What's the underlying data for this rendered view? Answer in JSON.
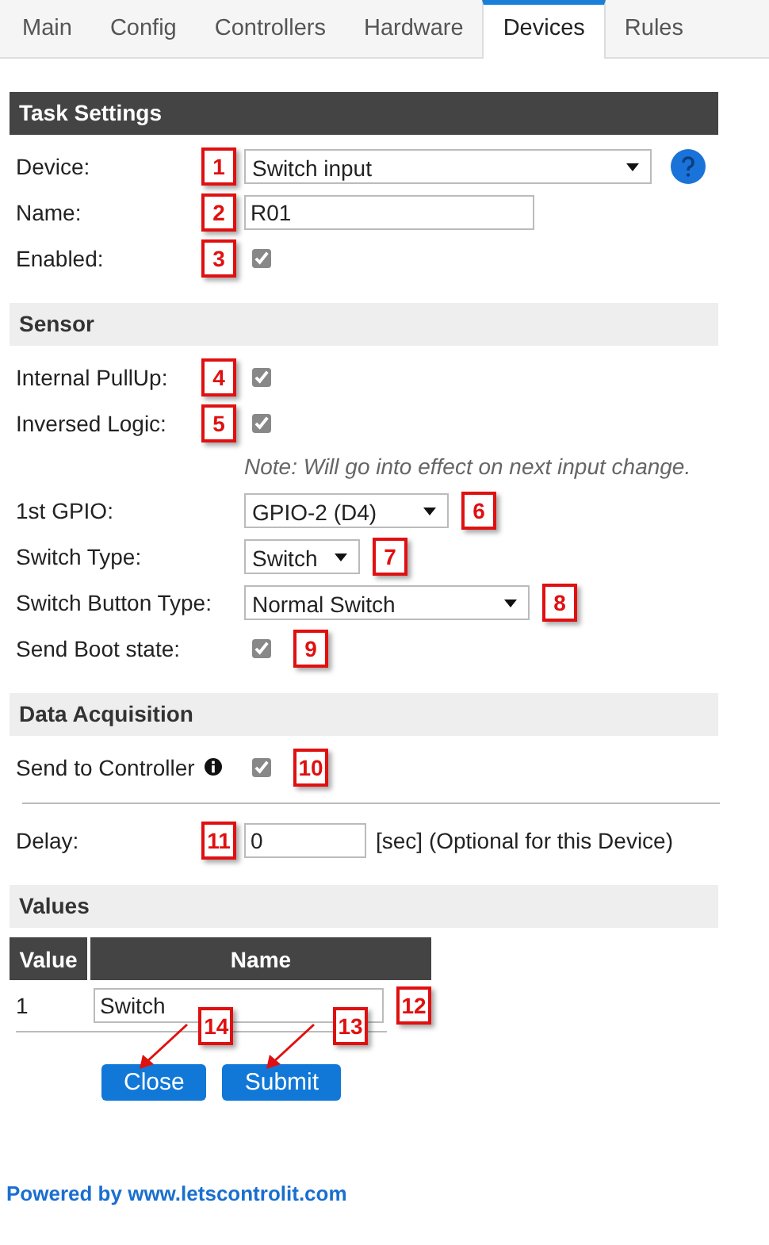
{
  "tabs": [
    {
      "label": "Main",
      "selected": false
    },
    {
      "label": "Config",
      "selected": false
    },
    {
      "label": "Controllers",
      "selected": false
    },
    {
      "label": "Hardware",
      "selected": false
    },
    {
      "label": "Devices",
      "selected": true
    },
    {
      "label": "Rules",
      "selected": false
    }
  ],
  "sections": [
    {
      "title": "Task Settings",
      "rows": [
        {
          "kind": "select",
          "label": "Device:",
          "value": "Switch input",
          "marker": "1",
          "marker_after": false,
          "help_icon": true
        },
        {
          "kind": "text",
          "label": "Name:",
          "value": "R01",
          "marker": "2",
          "marker_after": false
        },
        {
          "kind": "checkbox",
          "label": "Enabled:",
          "checked": true,
          "marker": "3",
          "marker_after": false
        }
      ]
    },
    {
      "title": "Sensor",
      "rows": [
        {
          "kind": "checkbox",
          "label": "Internal PullUp:",
          "checked": true,
          "marker": "4",
          "marker_after": false
        },
        {
          "kind": "checkbox",
          "label": "Inversed Logic:",
          "checked": true,
          "marker": "5",
          "marker_after": false
        },
        {
          "kind": "note",
          "text": "Note: Will go into effect on next input change."
        },
        {
          "kind": "select",
          "label": "1st GPIO:",
          "value": "GPIO-2 (D4)",
          "marker": "6",
          "marker_after": true
        },
        {
          "kind": "select",
          "label": "Switch Type:",
          "value": "Switch",
          "marker": "7",
          "marker_after": true
        },
        {
          "kind": "select",
          "label": "Switch Button Type:",
          "value": "Normal Switch",
          "marker": "8",
          "marker_after": true
        },
        {
          "kind": "checkbox",
          "label": "Send Boot state:",
          "checked": true,
          "marker": "9",
          "marker_after": true
        }
      ]
    },
    {
      "title": "Data Acquisition",
      "rows": [
        {
          "kind": "checkbox",
          "label": "Send to Controller",
          "info_icon": true,
          "checked": true,
          "marker": "10",
          "marker_after": true
        },
        {
          "kind": "divider"
        },
        {
          "kind": "text",
          "label": "Delay:",
          "value": "0",
          "suffix": "[sec] (Optional for this Device)",
          "marker": "11",
          "marker_after": false
        }
      ]
    }
  ],
  "values": {
    "title": "Values",
    "columns": [
      "Value",
      "Name"
    ],
    "rows": [
      {
        "value": "1",
        "name": "Switch",
        "marker": "12"
      }
    ]
  },
  "buttons": [
    {
      "label": "Close",
      "marker": "14"
    },
    {
      "label": "Submit",
      "marker": "13"
    }
  ],
  "footer": "Powered by www.letscontrolit.com"
}
